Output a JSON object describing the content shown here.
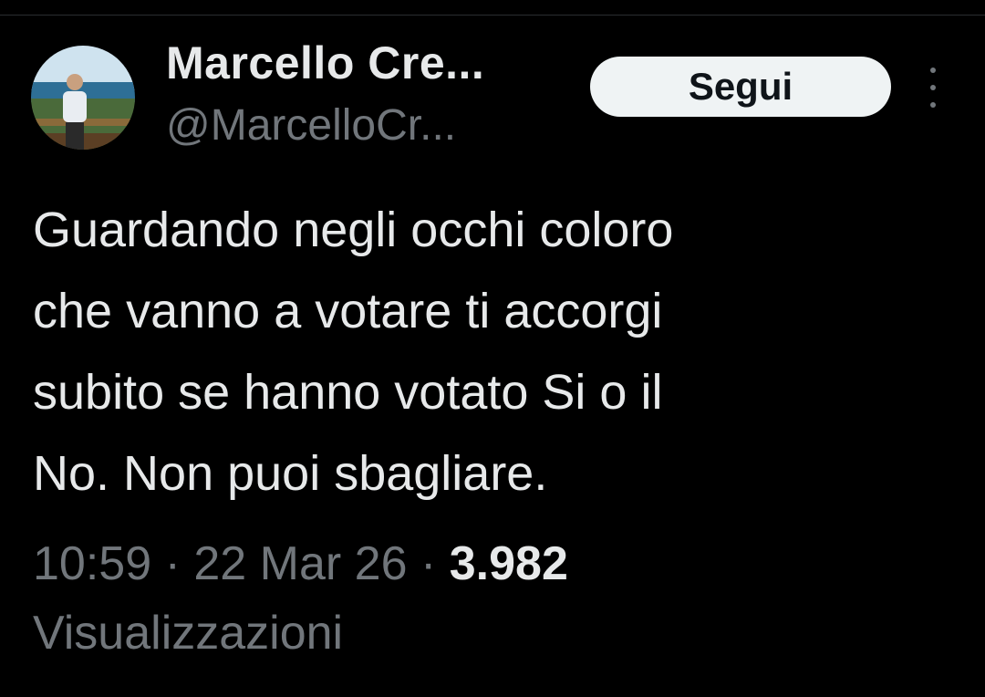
{
  "tweet": {
    "author": {
      "display_name": "Marcello Cre...",
      "handle": "@MarcelloCr...",
      "avatar_icon": "profile-photo"
    },
    "follow_button_label": "Segui",
    "more_icon": "more-vertical-icon",
    "text_lines": [
      "Guardando negli occhi coloro",
      "che vanno a votare ti accorgi",
      "subito se hanno votato Si o il",
      "No. Non puoi sbagliare."
    ],
    "time": "10:59",
    "separator": "·",
    "date": "22 Mar 26",
    "views_count": "3.982",
    "views_label": "Visualizzazioni"
  },
  "colors": {
    "background": "#000000",
    "primary_text": "#e7e9ea",
    "secondary_text": "#71767b",
    "button_bg": "#eff3f4",
    "button_text": "#0f1419"
  }
}
